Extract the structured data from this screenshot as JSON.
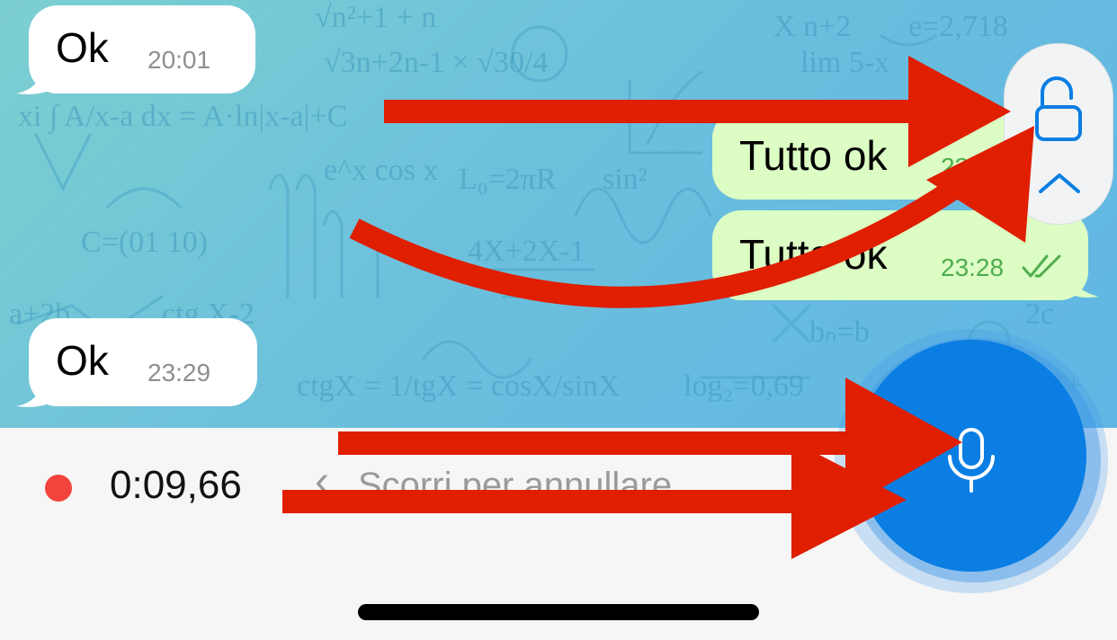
{
  "messages": [
    {
      "direction": "incoming",
      "text": "Ok",
      "time": "20:01"
    },
    {
      "direction": "outgoing",
      "text": "Tutto ok",
      "time": "23:28"
    },
    {
      "direction": "outgoing",
      "text": "Tutto ok",
      "time": "23:28"
    },
    {
      "direction": "incoming",
      "text": "Ok",
      "time": "23:29"
    }
  ],
  "recording": {
    "timer": "0:09,66",
    "cancel_hint": "Scorri per annullare",
    "chevron": "‹"
  },
  "icons": {
    "lock": "lock-open-icon",
    "chevron_up": "chevron-up-icon",
    "mic": "microphone-icon",
    "read_receipt": "double-check-icon"
  },
  "colors": {
    "wallpaper": "#6cc0dc",
    "incoming_bubble": "#ffffff",
    "outgoing_bubble": "#dcfdc4",
    "accent": "#0a7ee3",
    "record_dot": "#f2443c",
    "annotation_arrow": "#e01e00"
  }
}
